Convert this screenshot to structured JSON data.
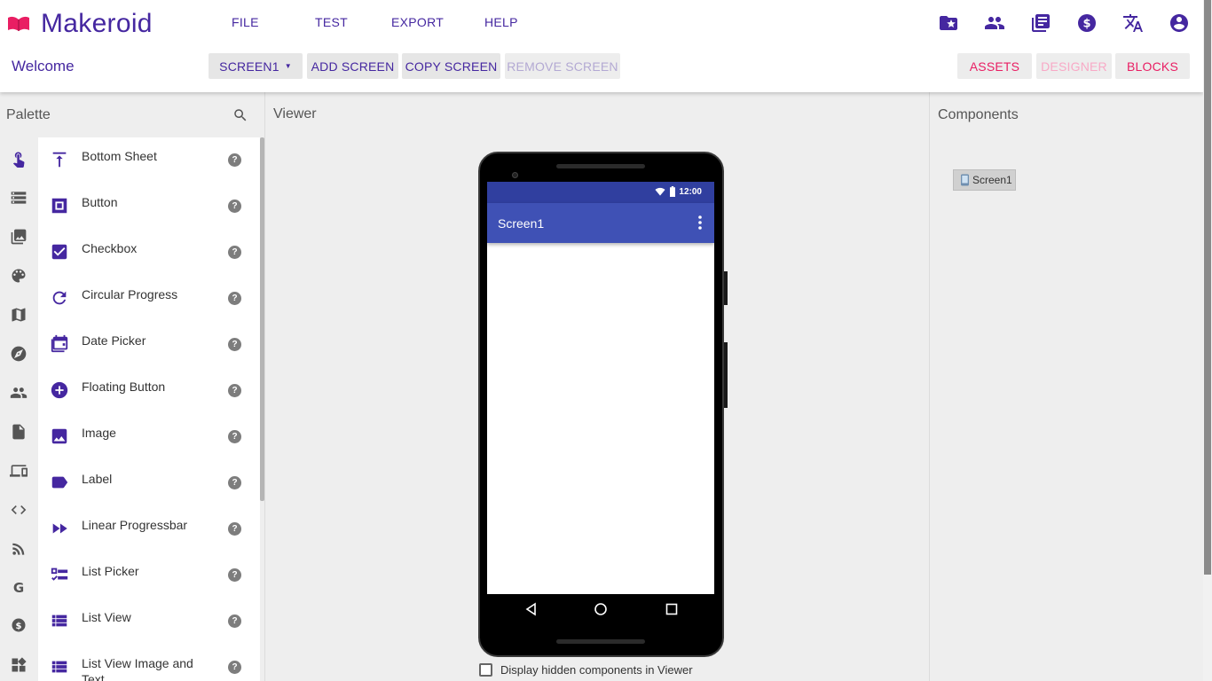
{
  "app": {
    "name": "Makeroid",
    "brand_color": "#4527a0",
    "accent": "#e91e63"
  },
  "menu": {
    "file": "FILE",
    "test": "TEST",
    "export": "EXPORT",
    "help": "HELP"
  },
  "welcome": "Welcome",
  "toolbar": {
    "screen_select": "SCREEN1",
    "add_screen": "ADD SCREEN",
    "copy_screen": "COPY SCREEN",
    "remove_screen": "REMOVE SCREEN",
    "assets": "ASSETS",
    "designer": "DESIGNER",
    "blocks": "BLOCKS"
  },
  "top_icons": [
    "folder-star-icon",
    "people-icon",
    "library-books-icon",
    "dollar-icon",
    "translate-icon",
    "account-circle-icon"
  ],
  "palette": {
    "title": "Palette",
    "categories": [
      "touch-icon",
      "storage-icon",
      "media-icon",
      "palette-icon",
      "map-icon",
      "explore-icon",
      "people-icon",
      "document-icon",
      "devices-icon",
      "code-icon",
      "rss-icon",
      "google-icon",
      "dollar-icon",
      "widgets-icon"
    ],
    "items": [
      {
        "label": "Bottom Sheet",
        "icon": "vertical-align-top-icon"
      },
      {
        "label": "Button",
        "icon": "button-icon"
      },
      {
        "label": "Checkbox",
        "icon": "check-box-icon"
      },
      {
        "label": "Circular Progress",
        "icon": "rotate-icon"
      },
      {
        "label": "Date Picker",
        "icon": "calendar-icon"
      },
      {
        "label": "Floating Button",
        "icon": "add-circle-icon"
      },
      {
        "label": "Image",
        "icon": "image-icon"
      },
      {
        "label": "Label",
        "icon": "label-icon"
      },
      {
        "label": "Linear Progressbar",
        "icon": "fast-forward-icon"
      },
      {
        "label": "List Picker",
        "icon": "checklist-icon"
      },
      {
        "label": "List View",
        "icon": "list-icon"
      },
      {
        "label": "List View Image and Text",
        "icon": "list-icon"
      }
    ],
    "help_glyph": "?"
  },
  "viewer": {
    "title": "Viewer",
    "status_time": "12:00",
    "screen_title": "Screen1",
    "hidden_checkbox_label": "Display hidden components in Viewer"
  },
  "components": {
    "title": "Components",
    "tree": [
      {
        "label": "Screen1"
      }
    ]
  }
}
